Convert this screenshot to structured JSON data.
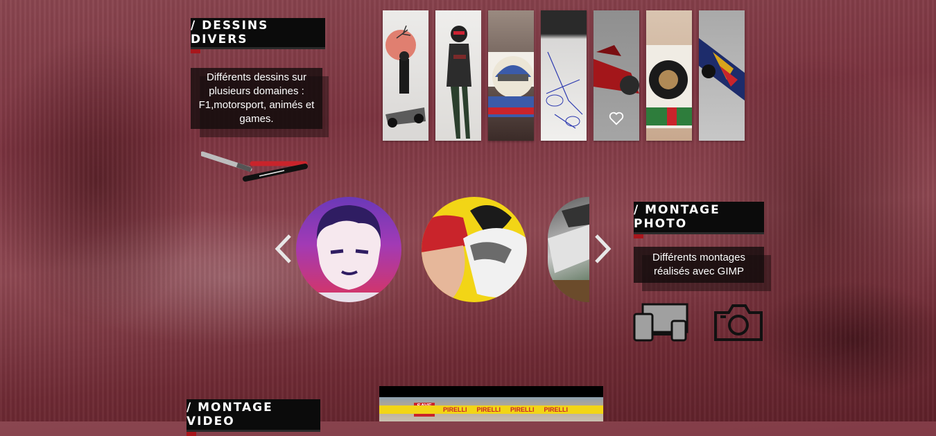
{
  "dessins": {
    "title": "/ DESSINS DIVERS",
    "description": "Différents dessins sur plusieurs domaines : F1,motorsport, animés et games."
  },
  "montage_photo": {
    "title": "/ MONTAGE PHOTO",
    "description": "Différents montages réalisés avec GIMP"
  },
  "montage_video": {
    "title": "/ MONTAGE VIDEO"
  },
  "gallery": {
    "like_icon": "heart-icon",
    "items": 7
  },
  "slider": {
    "prev_icon": "chevron-left-icon",
    "next_icon": "chevron-right-icon"
  },
  "icons": {
    "devices": "devices-icon",
    "camera": "camera-icon",
    "pens": "pens-icon"
  },
  "video_banner": [
    "SAVE",
    "PIRELLI",
    "PIRELLI",
    "PIRELLI",
    "PIRELLI"
  ],
  "colors": {
    "accent": "#a8161c",
    "box": "#0b0b0b"
  }
}
